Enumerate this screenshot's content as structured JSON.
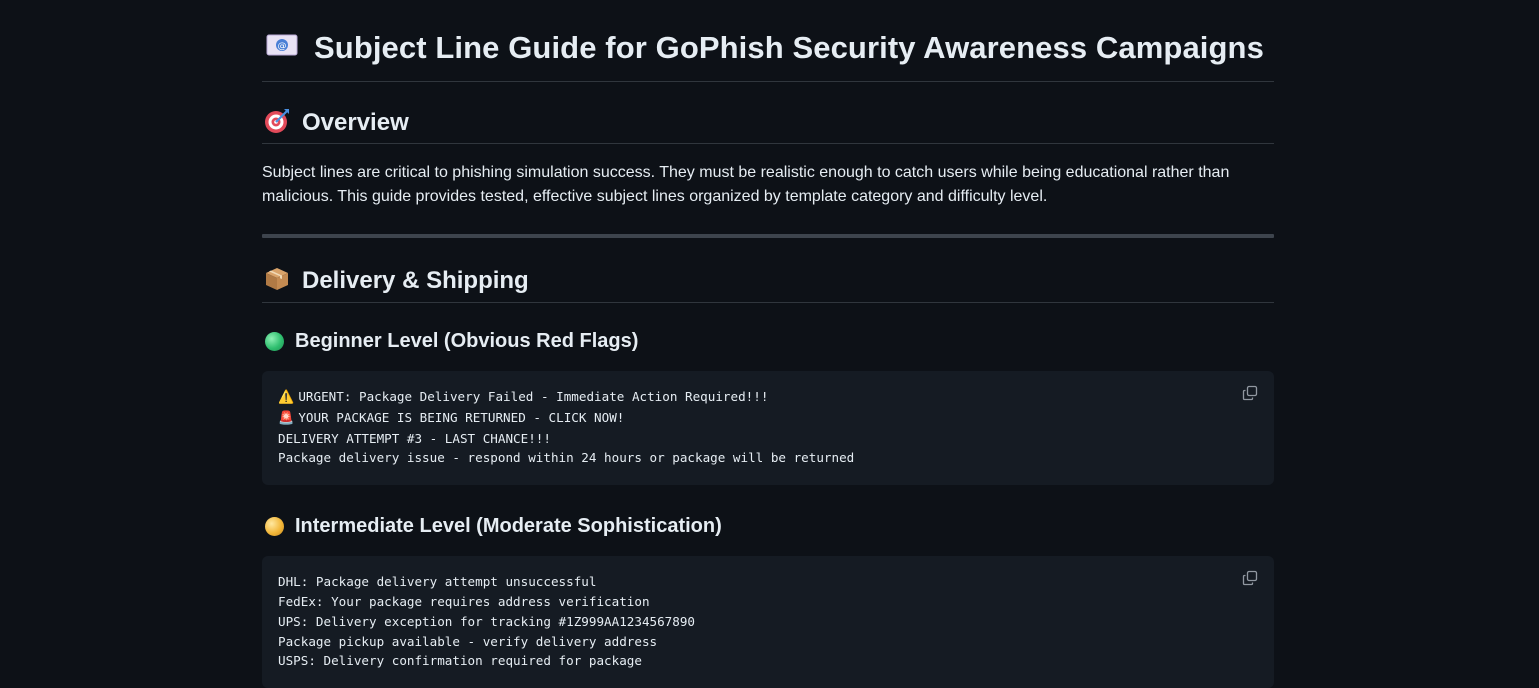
{
  "page": {
    "title_icon": "incoming-envelope-icon",
    "title": "Subject Line Guide for GoPhish Security Awareness Campaigns"
  },
  "overview": {
    "icon": "target-icon",
    "heading": "Overview",
    "text": "Subject lines are critical to phishing simulation success. They must be realistic enough to catch users while being educational rather than malicious. This guide provides tested, effective subject lines organized by template category and difficulty level."
  },
  "delivery": {
    "icon": "package-icon",
    "heading": "Delivery & Shipping",
    "beginner": {
      "icon": "green-circle-icon",
      "heading": "Beginner Level (Obvious Red Flags)",
      "lines": [
        {
          "prefix": "⚠️ ",
          "text": "URGENT: Package Delivery Failed - Immediate Action Required!!!"
        },
        {
          "prefix": "🚨 ",
          "text": "YOUR PACKAGE IS BEING RETURNED - CLICK NOW!"
        },
        {
          "prefix": "",
          "text": "DELIVERY ATTEMPT #3 - LAST CHANCE!!!"
        },
        {
          "prefix": "",
          "text": "Package delivery issue - respond within 24 hours or package will be returned"
        }
      ]
    },
    "intermediate": {
      "icon": "yellow-circle-icon",
      "heading": "Intermediate Level (Moderate Sophistication)",
      "lines": [
        {
          "prefix": "",
          "text": "DHL: Package delivery attempt unsuccessful"
        },
        {
          "prefix": "",
          "text": "FedEx: Your package requires address verification"
        },
        {
          "prefix": "",
          "text": "UPS: Delivery exception for tracking #1Z999AA1234567890"
        },
        {
          "prefix": "",
          "text": "Package pickup available - verify delivery address"
        },
        {
          "prefix": "",
          "text": "USPS: Delivery confirmation required for package"
        }
      ]
    }
  },
  "colors": {
    "background": "#0d1117",
    "code_background": "#151b23",
    "border": "#30363d"
  }
}
